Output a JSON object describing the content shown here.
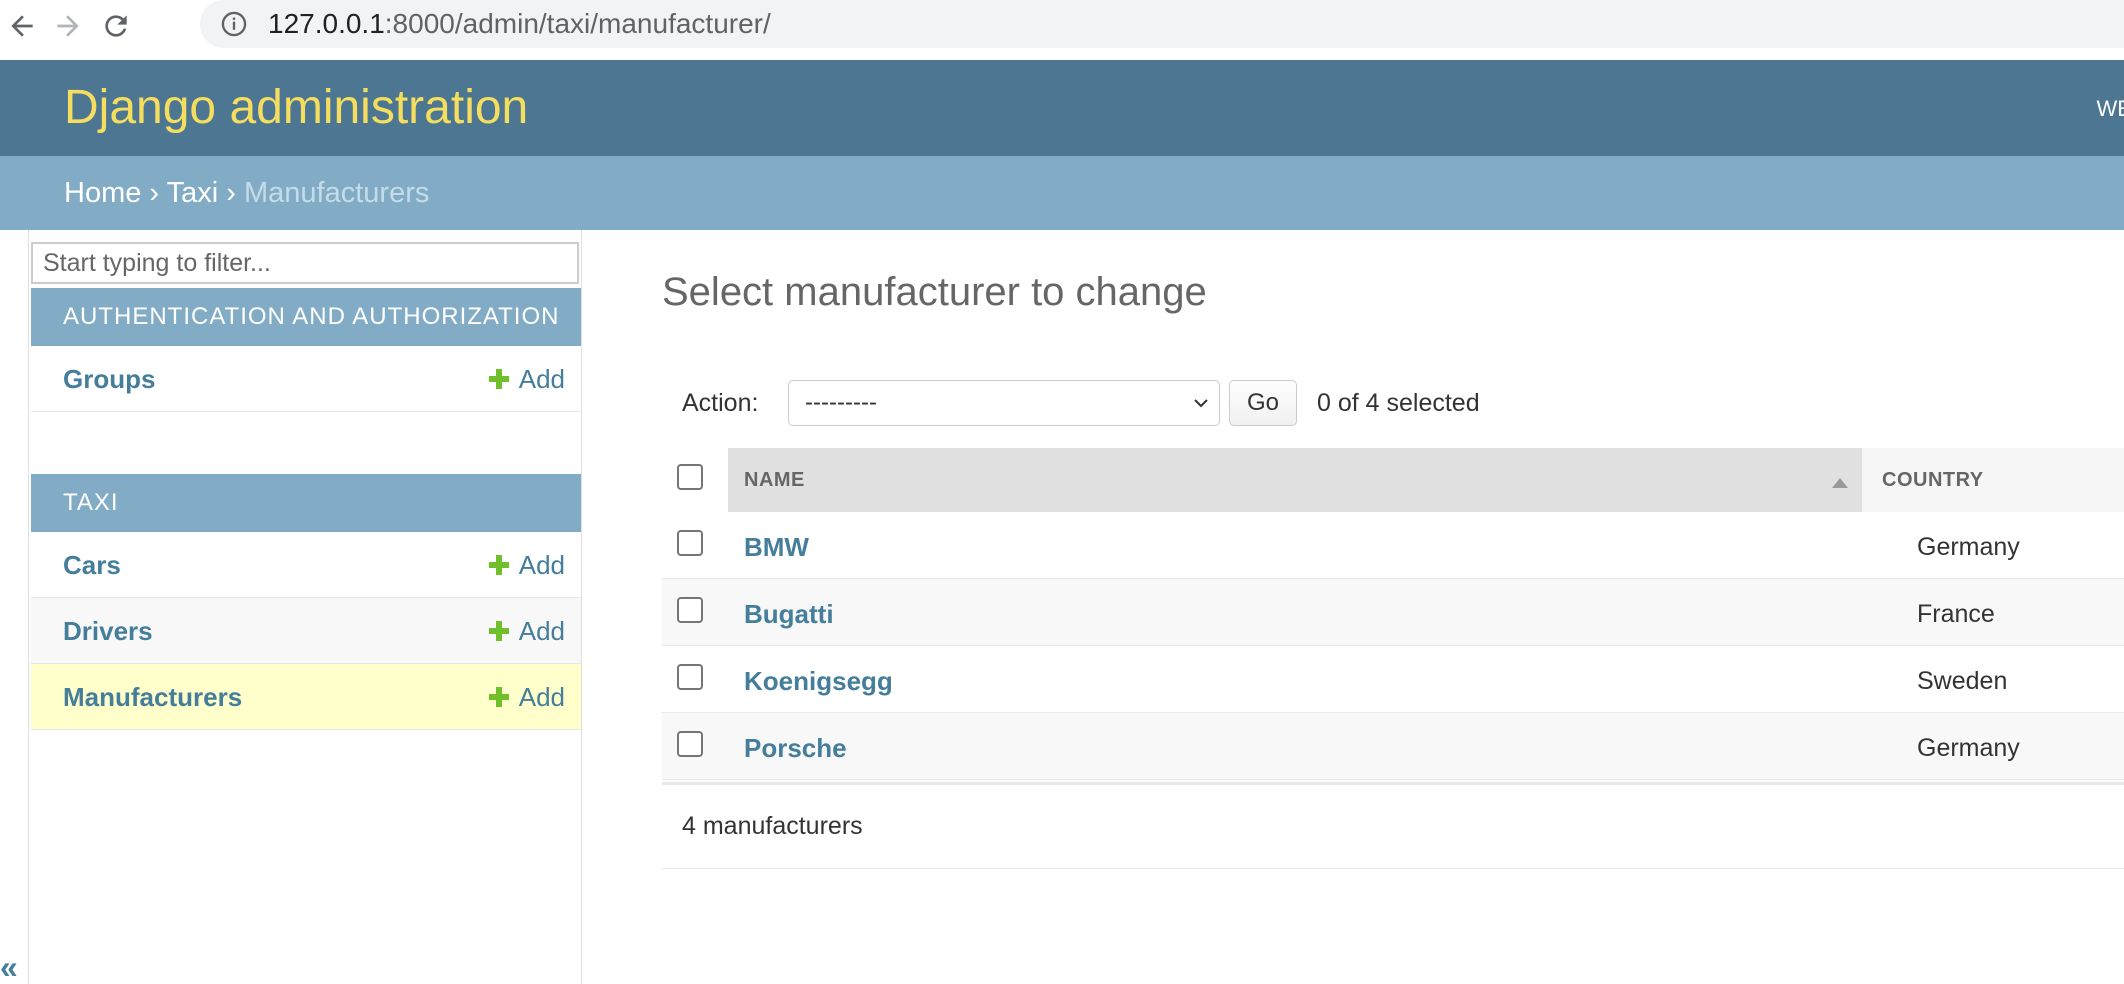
{
  "browser": {
    "url_host": "127.0.0.1",
    "url_rest": ":8000/admin/taxi/manufacturer/"
  },
  "header": {
    "site_name": "Django administration",
    "user_tools": "WE"
  },
  "breadcrumbs": {
    "home": "Home",
    "sep": "›",
    "app": "Taxi",
    "current": "Manufacturers"
  },
  "sidebar": {
    "filter_placeholder": "Start typing to filter...",
    "modules": [
      {
        "caption": "AUTHENTICATION AND AUTHORIZATION",
        "models": [
          {
            "name": "Groups",
            "add": "Add"
          }
        ]
      },
      {
        "caption": "TAXI",
        "models": [
          {
            "name": "Cars",
            "add": "Add"
          },
          {
            "name": "Drivers",
            "add": "Add"
          },
          {
            "name": "Manufacturers",
            "add": "Add"
          }
        ]
      }
    ],
    "collapse_label": "«"
  },
  "content": {
    "title": "Select manufacturer to change",
    "actions": {
      "label": "Action:",
      "selected_option": "---------",
      "go": "Go",
      "counter": "0 of 4 selected"
    },
    "table": {
      "columns": [
        "NAME",
        "COUNTRY"
      ],
      "rows": [
        {
          "name": "BMW",
          "country": "Germany"
        },
        {
          "name": "Bugatti",
          "country": "France"
        },
        {
          "name": "Koenigsegg",
          "country": "Sweden"
        },
        {
          "name": "Porsche",
          "country": "Germany"
        }
      ]
    },
    "paginator": "4 manufacturers"
  },
  "colors": {
    "header_bg": "#4c7692",
    "breadcrumbs_bg": "#82acc5",
    "site_name": "#f5dd5d",
    "link": "#447e9b",
    "add_icon": "#70bf2b",
    "current_row_bg": "#ffffcc"
  }
}
